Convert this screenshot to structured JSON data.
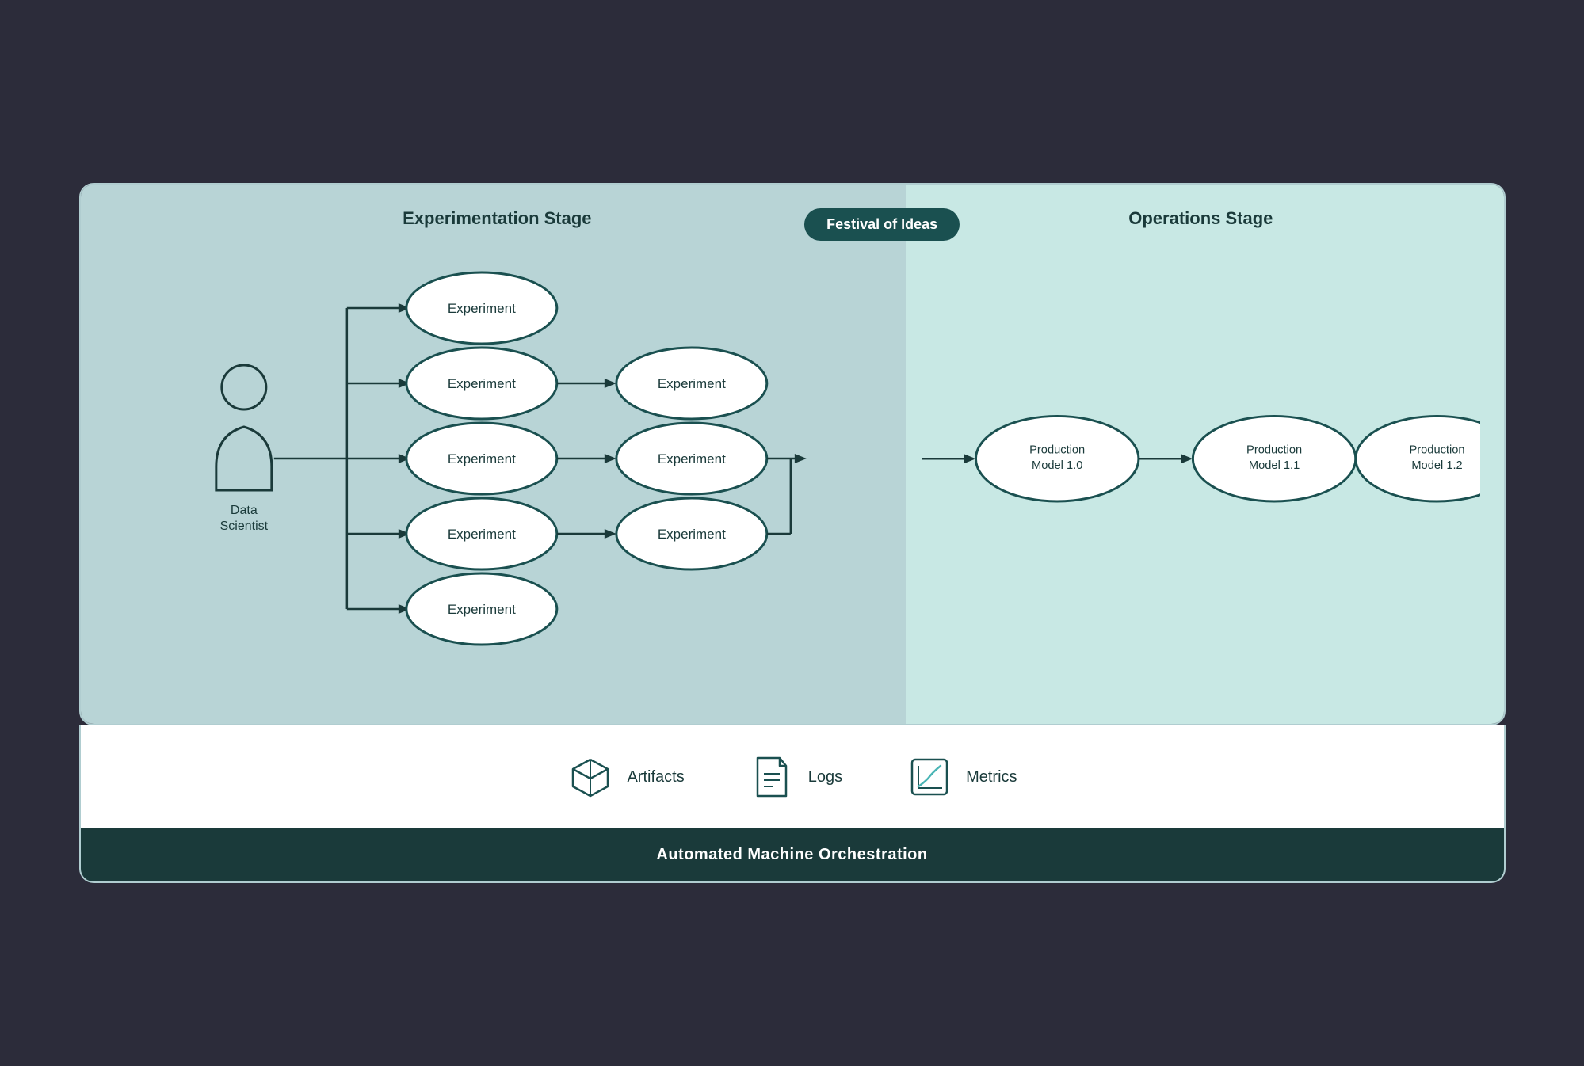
{
  "diagram": {
    "exp_stage_title": "Experimentation Stage",
    "ops_stage_title": "Operations Stage",
    "festival_badge": "Festival of Ideas",
    "data_scientist_label": "Data\nScientist",
    "nodes": {
      "experiments": [
        "Experiment",
        "Experiment",
        "Experiment",
        "Experiment",
        "Experiment",
        "Experiment",
        "Experiment",
        "Experiment"
      ],
      "production": [
        "Production\nModel 1.0",
        "Production\nModel 1.1",
        "Production\nModel 1.2"
      ]
    }
  },
  "legend": {
    "items": [
      {
        "label": "Artifacts",
        "icon": "box-icon"
      },
      {
        "label": "Logs",
        "icon": "document-icon"
      },
      {
        "label": "Metrics",
        "icon": "chart-icon"
      }
    ]
  },
  "footer": {
    "text": "Automated Machine Orchestration"
  },
  "colors": {
    "teal_dark": "#1a5050",
    "teal_medium": "#2d6a6a",
    "exp_bg": "#b8d4d6",
    "ops_bg": "#c8e8e4",
    "node_stroke": "#1a5050",
    "arrow_color": "#1a3a3a"
  }
}
